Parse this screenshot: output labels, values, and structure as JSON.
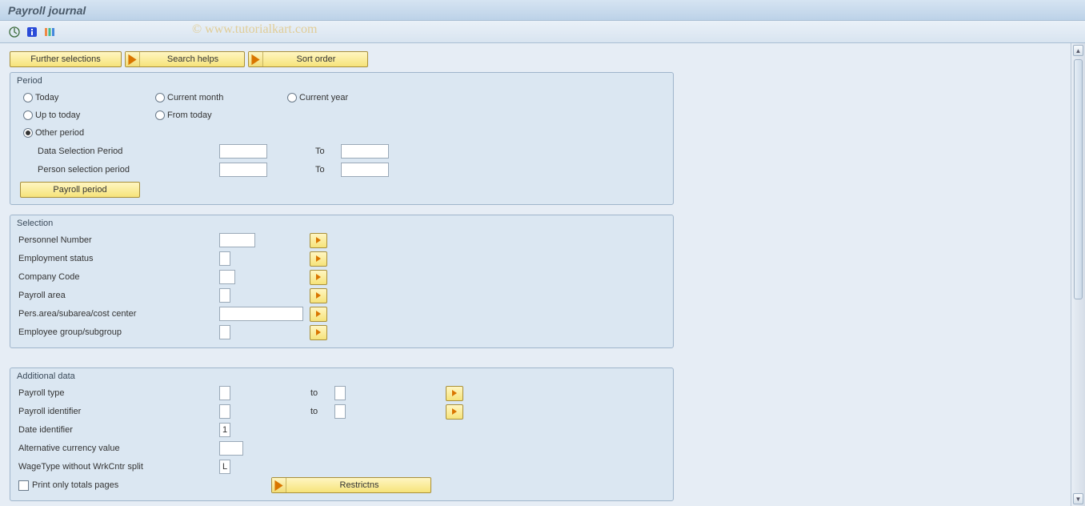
{
  "title": "Payroll journal",
  "watermark": "© www.tutorialkart.com",
  "topButtons": {
    "further": "Further selections",
    "search": "Search helps",
    "sort": "Sort order"
  },
  "period": {
    "title": "Period",
    "today": "Today",
    "currentMonth": "Current month",
    "currentYear": "Current year",
    "upToToday": "Up to today",
    "fromToday": "From today",
    "otherPeriod": "Other period",
    "dataSelPeriod": "Data Selection Period",
    "personSelPeriod": "Person selection period",
    "to": "To",
    "payrollPeriodBtn": "Payroll period"
  },
  "selection": {
    "title": "Selection",
    "personnelNumber": "Personnel Number",
    "employmentStatus": "Employment status",
    "companyCode": "Company Code",
    "payrollArea": "Payroll area",
    "persArea": "Pers.area/subarea/cost center",
    "empGroup": "Employee group/subgroup"
  },
  "additional": {
    "title": "Additional data",
    "payrollType": "Payroll type",
    "payrollIdentifier": "Payroll identifier",
    "to": "to",
    "dateIdentifier": "Date identifier",
    "dateIdentifierVal": "1",
    "altCurrency": "Alternative currency value",
    "wageType": "WageType without WrkCntr split",
    "wageTypeVal": "L",
    "printOnly": "Print only totals pages",
    "restrictions": "Restrictns"
  }
}
